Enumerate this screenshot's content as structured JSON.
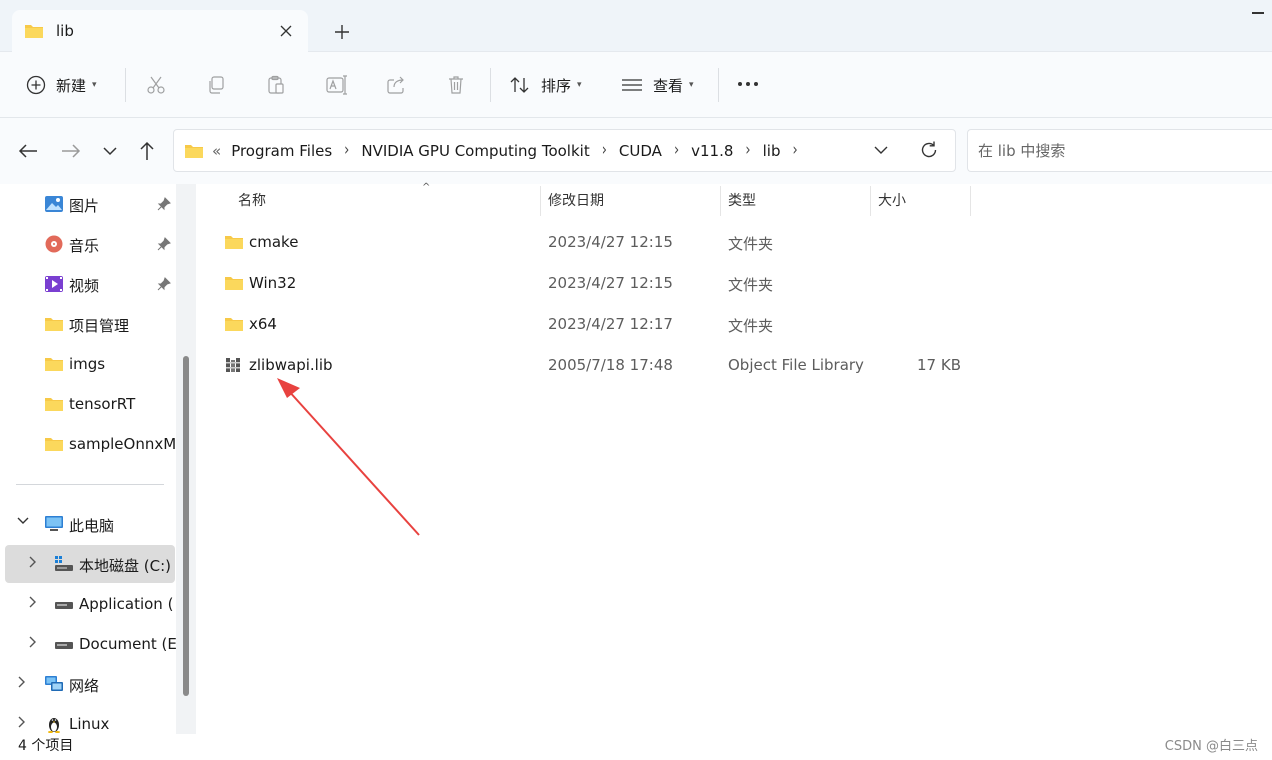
{
  "window": {
    "tab_title": "lib",
    "tab_icon": "folder-icon",
    "new_tab_icon": "plus-icon",
    "close_icon": "close-icon"
  },
  "toolbar": {
    "new_label": "新建",
    "sort_label": "排序",
    "view_label": "查看",
    "icons": [
      "cut-icon",
      "copy-icon",
      "paste-icon",
      "rename-icon",
      "share-icon",
      "delete-icon",
      "more-icon"
    ]
  },
  "address": {
    "lead": "«",
    "crumbs": [
      "Program Files",
      "NVIDIA GPU Computing Toolkit",
      "CUDA",
      "v11.8",
      "lib"
    ]
  },
  "search": {
    "placeholder": "在 lib 中搜索"
  },
  "sidebar": {
    "quick": [
      {
        "label": "图片",
        "icon": "pictures-icon",
        "pinned": true
      },
      {
        "label": "音乐",
        "icon": "music-icon",
        "pinned": true
      },
      {
        "label": "视频",
        "icon": "video-icon",
        "pinned": true
      },
      {
        "label": "项目管理",
        "icon": "folder-icon",
        "pinned": false
      },
      {
        "label": "imgs",
        "icon": "folder-icon",
        "pinned": false
      },
      {
        "label": "tensorRT",
        "icon": "folder-icon",
        "pinned": false
      },
      {
        "label": "sampleOnnxM",
        "icon": "folder-icon",
        "pinned": false
      }
    ],
    "this_pc": "此电脑",
    "drives": [
      {
        "label": "本地磁盘 (C:)",
        "selected": true
      },
      {
        "label": "Application (",
        "selected": false
      },
      {
        "label": "Document (E:",
        "selected": false
      }
    ],
    "network": "网络",
    "linux": "Linux"
  },
  "columns": {
    "name": "名称",
    "date": "修改日期",
    "type": "类型",
    "size": "大小"
  },
  "files": [
    {
      "name": "cmake",
      "date": "2023/4/27 12:15",
      "type": "文件夹",
      "size": "",
      "icon": "folder-icon"
    },
    {
      "name": "Win32",
      "date": "2023/4/27 12:15",
      "type": "文件夹",
      "size": "",
      "icon": "folder-icon"
    },
    {
      "name": "x64",
      "date": "2023/4/27 12:17",
      "type": "文件夹",
      "size": "",
      "icon": "folder-icon"
    },
    {
      "name": "zlibwapi.lib",
      "date": "2005/7/18 17:48",
      "type": "Object File Library",
      "size": "17 KB",
      "icon": "library-file-icon"
    }
  ],
  "status": {
    "count": "4 个项目",
    "watermark": "CSDN @白三点"
  },
  "colors": {
    "accent_arrow": "#e8423f",
    "folder": "#f7c948",
    "selected_bg": "#dcdcdc",
    "chrome_bg": "#eff4f9"
  }
}
